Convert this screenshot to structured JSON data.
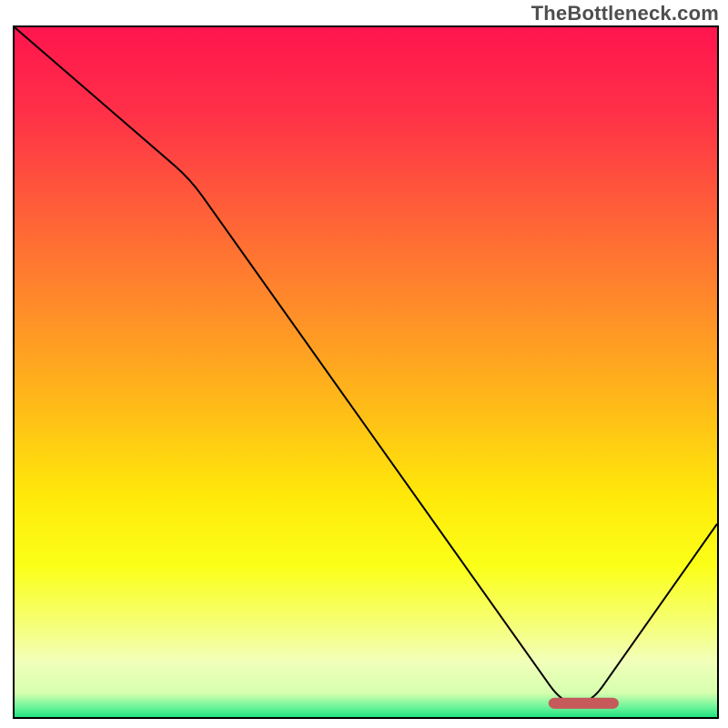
{
  "watermark": "TheBottleneck.com",
  "colors": {
    "border": "#000000",
    "line": "#000000",
    "marker": "#c65a5a",
    "gradient_stops": [
      {
        "offset": 0.0,
        "color": "#ff154e"
      },
      {
        "offset": 0.12,
        "color": "#ff2f48"
      },
      {
        "offset": 0.25,
        "color": "#ff5a3a"
      },
      {
        "offset": 0.4,
        "color": "#ff8a2a"
      },
      {
        "offset": 0.55,
        "color": "#ffbb18"
      },
      {
        "offset": 0.68,
        "color": "#ffe90a"
      },
      {
        "offset": 0.78,
        "color": "#fbff18"
      },
      {
        "offset": 0.86,
        "color": "#f6ff70"
      },
      {
        "offset": 0.92,
        "color": "#f1ffba"
      },
      {
        "offset": 0.965,
        "color": "#d6ffae"
      },
      {
        "offset": 0.985,
        "color": "#6ef59a"
      },
      {
        "offset": 1.0,
        "color": "#21e27f"
      }
    ]
  },
  "chart_data": {
    "type": "line",
    "title": "",
    "xlabel": "",
    "ylabel": "",
    "xlim": [
      0,
      100
    ],
    "ylim": [
      0,
      100
    ],
    "legend": null,
    "grid": false,
    "series": [
      {
        "name": "bottleneck-curve",
        "x": [
          0,
          25,
          78,
          82,
          100
        ],
        "y": [
          100,
          78,
          2,
          2,
          28
        ]
      }
    ],
    "marker": {
      "x_start": 76,
      "x_end": 86,
      "y": 2,
      "thickness": 1.6
    },
    "background": "vertical-gradient"
  }
}
